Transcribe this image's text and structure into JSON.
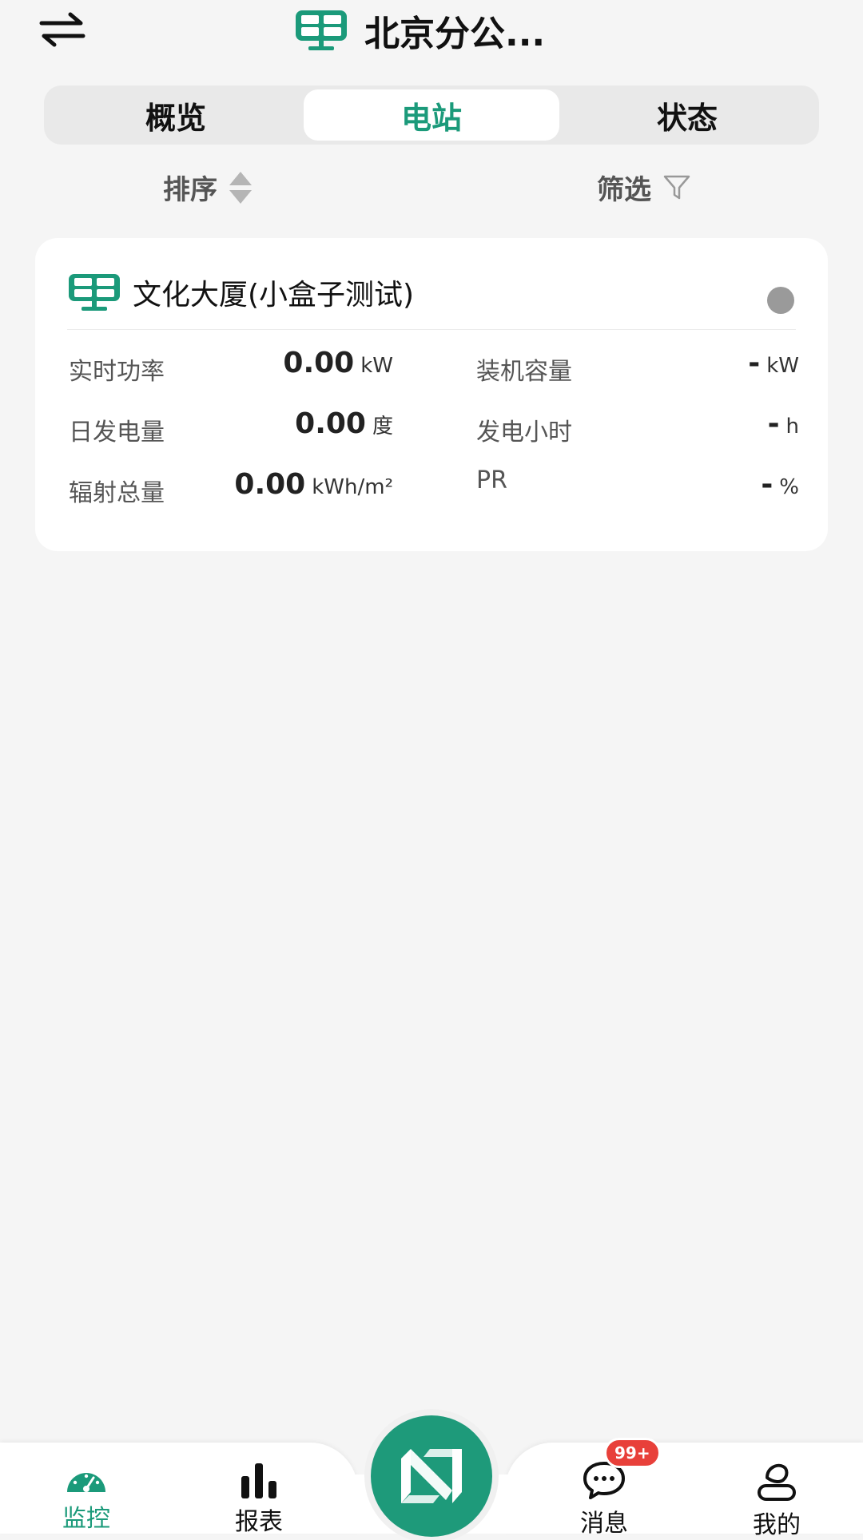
{
  "header": {
    "title": "北京分公...",
    "swap_icon": "swap-arrows-icon",
    "station_icon": "solar-panel-icon"
  },
  "tabs": [
    {
      "label": "概览",
      "active": false
    },
    {
      "label": "电站",
      "active": true
    },
    {
      "label": "状态",
      "active": false
    }
  ],
  "toolbar": {
    "sort_label": "排序",
    "filter_label": "筛选"
  },
  "station": {
    "name": "文化大厦(小盒子测试)",
    "status_color": "#9a9a9a",
    "metrics": {
      "realtime_power_label": "实时功率",
      "realtime_power_value": "0.00",
      "realtime_power_unit": "kW",
      "installed_capacity_label": "装机容量",
      "installed_capacity_value": "-",
      "installed_capacity_unit": "kW",
      "daily_generation_label": "日发电量",
      "daily_generation_value": "0.00",
      "daily_generation_unit": "度",
      "generation_hours_label": "发电小时",
      "generation_hours_value": "-",
      "generation_hours_unit": "h",
      "total_radiation_label": "辐射总量",
      "total_radiation_value": "0.00",
      "total_radiation_unit": "kWh/m²",
      "pr_label": "PR",
      "pr_value": "-",
      "pr_unit": "%"
    }
  },
  "nav": {
    "monitor_label": "监控",
    "report_label": "报表",
    "message_label": "消息",
    "message_badge": "99+",
    "mine_label": "我的",
    "active": "监控"
  },
  "colors": {
    "accent": "#1b9a7a",
    "badge": "#e8403a",
    "background": "#f5f5f5"
  }
}
